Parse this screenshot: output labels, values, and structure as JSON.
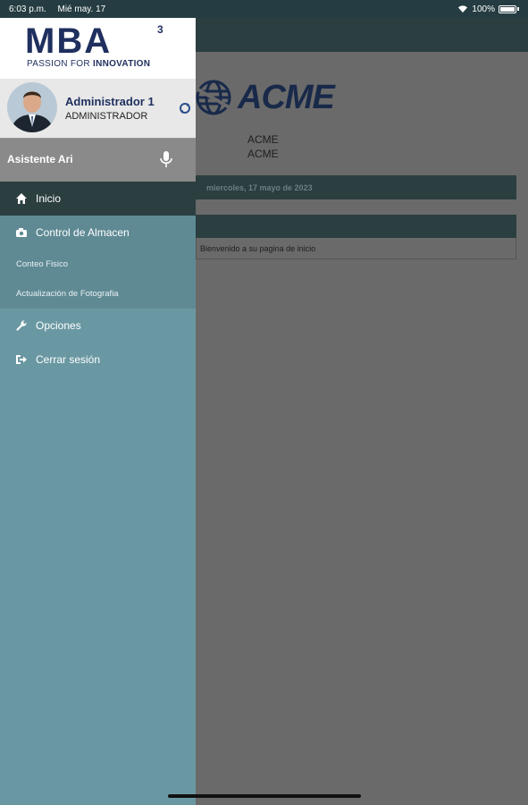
{
  "status_bar": {
    "time": "6:03 p.m.",
    "date": "Mié may. 17",
    "battery": "100%"
  },
  "page": {
    "logo_text": "ACME",
    "company_line1": "ACME",
    "company_line2": "ACME",
    "date_text": "miercoles, 17 mayo de 2023",
    "welcome_text": "Bienvenido a su pagina de inicio"
  },
  "drawer": {
    "brand": {
      "logo": "MBA",
      "superscript": "3",
      "tagline_prefix": "PASSION FOR ",
      "tagline_bold": "INNOVATION"
    },
    "profile": {
      "name": "Administrador 1",
      "role": "ADMINISTRADOR"
    },
    "assistant": {
      "label": "Asistente Ari"
    },
    "menu": [
      {
        "label": "Inicio",
        "icon": "home-icon"
      },
      {
        "label": "Control de Almacen",
        "icon": "camera-icon"
      },
      {
        "label": "Opciones",
        "icon": "wrench-icon"
      },
      {
        "label": "Cerrar sesión",
        "icon": "logout-icon"
      }
    ],
    "submenu": [
      {
        "label": "Conteo Fisico"
      },
      {
        "label": "Actualización de Fotografia"
      }
    ]
  },
  "colors": {
    "drawer_bg": "#6a98a2",
    "active_item": "#2b3e40",
    "brand_navy": "#1f2f5e",
    "overlay": "#6a6a6a"
  }
}
